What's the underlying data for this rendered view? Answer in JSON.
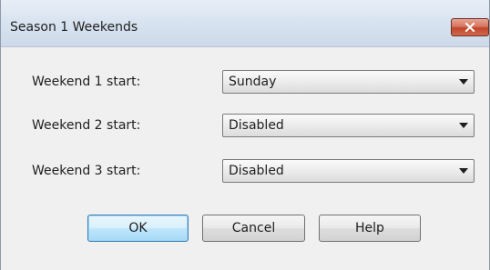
{
  "window": {
    "title": "Season 1 Weekends"
  },
  "fields": [
    {
      "label": "Weekend 1 start:",
      "value": "Sunday"
    },
    {
      "label": "Weekend 2 start:",
      "value": "Disabled"
    },
    {
      "label": "Weekend 3 start:",
      "value": "Disabled"
    }
  ],
  "buttons": {
    "ok": "OK",
    "cancel": "Cancel",
    "help": "Help"
  },
  "icons": {
    "close": "close-icon",
    "dropdown": "chevron-down-icon"
  },
  "colors": {
    "close_button": "#c1452c",
    "default_button_border": "#3c7fb1"
  }
}
